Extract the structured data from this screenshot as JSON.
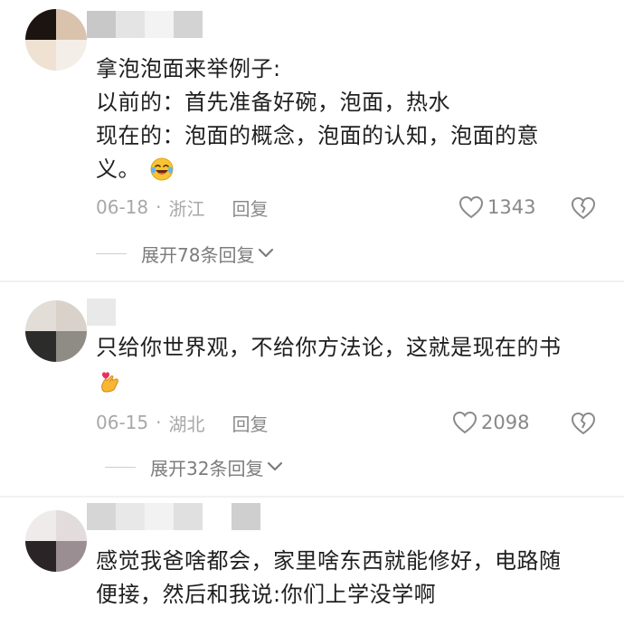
{
  "comments": [
    {
      "lines": [
        "拿泡泡面来举例子:",
        "以前的：首先准备好碗，泡面，热水",
        "现在的：泡面的概念，泡面的认知，泡面的意",
        "义。"
      ],
      "emoji": "laughing-tears-emoji",
      "date": "06-18",
      "separator": "·",
      "location": "浙江",
      "reply_label": "回复",
      "likes": "1343",
      "expand_label": "展开78条回复"
    },
    {
      "lines": [
        "只给你世界观，不给你方法论，这就是现在的书"
      ],
      "emoji": "finger-heart-emoji",
      "date": "06-15",
      "separator": "·",
      "location": "湖北",
      "reply_label": "回复",
      "likes": "2098",
      "expand_label": "展开32条回复"
    },
    {
      "lines": [
        "感觉我爸啥都会，家里啥东西就能修好，电路随",
        "便接，然后和我说:你们上学没学啊"
      ]
    }
  ],
  "icons": {
    "like": "heart-outline-icon",
    "dislike": "broken-heart-icon",
    "expand": "chevron-down-icon"
  },
  "colors": {
    "text": "#1f1f1f",
    "meta": "#a8a8a8",
    "icon": "#888888"
  }
}
